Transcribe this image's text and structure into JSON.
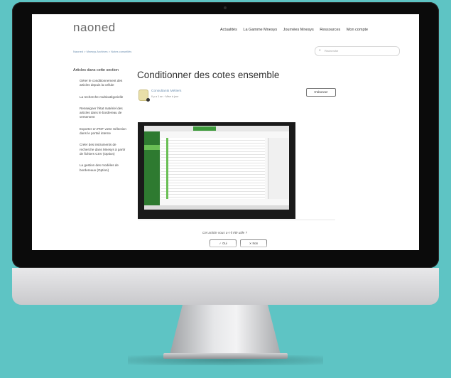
{
  "header": {
    "logo": "naoned",
    "nav": [
      "Actualités",
      "La Gamme Mnesys",
      "Journées Mnesys",
      "Ressources",
      "Mon compte"
    ]
  },
  "breadcrumb": "Naoned > Mnesys Archives > Notes conseillés",
  "search": {
    "placeholder": "Recherche"
  },
  "sidebar": {
    "title": "Articles dans cette section",
    "items": [
      "Gérer le conditionnement des articles depuis la cellule",
      "La recherche multicatégorielle",
      "Renseigner l'état matériel des articles dans le bordereau de versement",
      "Exporter en PDF votre Sélection dans le portail interne",
      "Créer des instruments de recherche dans Mnesys à partir de fichiers CSV (Option)",
      "La gestion des modèles de bordereaux (Option)"
    ]
  },
  "article": {
    "title": "Conditionner des cotes ensemble",
    "author": "Consultants Métiers",
    "meta": "Il y a 1 an · Mise à jour",
    "follow_label": "S'abonner",
    "question": "Cet article vous a-t-il été utile ?",
    "yes_label": "✓ Oui",
    "no_label": "✕ Non"
  },
  "colors": {
    "background": "#5ec4c4",
    "link": "#6d8fb0",
    "app_green": "#3e9a3c"
  }
}
